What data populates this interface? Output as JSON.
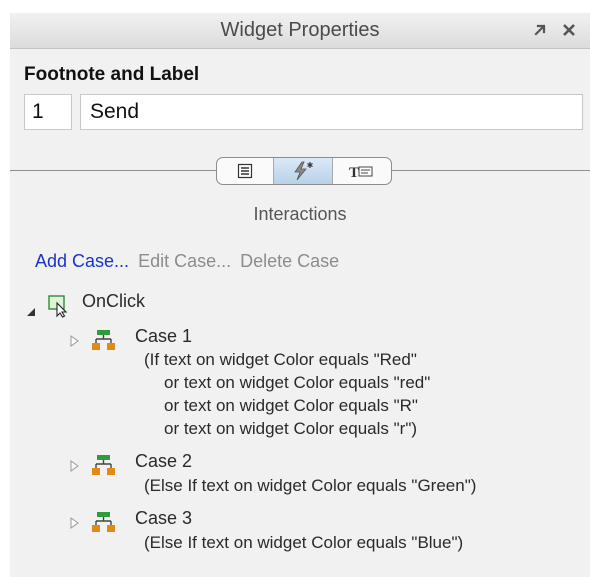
{
  "window": {
    "title": "Widget Properties",
    "pin_icon": "pin-icon",
    "close_icon": "close-icon"
  },
  "section": {
    "title": "Footnote and Label",
    "footnote_value": "1",
    "label_value": "Send"
  },
  "tabs": [
    {
      "name": "style",
      "icon": "notes-icon"
    },
    {
      "name": "interactions",
      "icon": "lightning-icon",
      "selected": true
    },
    {
      "name": "notes",
      "icon": "text-field-icon"
    }
  ],
  "subheading": "Interactions",
  "actions": {
    "add": "Add Case...",
    "edit": "Edit Case...",
    "delete": "Delete Case"
  },
  "event": {
    "name": "OnClick",
    "cases": [
      {
        "name": "Case 1",
        "conditions": [
          "(If text on widget Color equals \"Red\"",
          "or text on widget Color equals \"red\"",
          "or text on widget Color equals \"R\"",
          "or text on widget Color equals \"r\")"
        ]
      },
      {
        "name": "Case 2",
        "conditions": [
          "(Else If text on widget Color equals \"Green\")"
        ]
      },
      {
        "name": "Case 3",
        "conditions": [
          "(Else If text on widget Color equals \"Blue\")"
        ]
      }
    ]
  },
  "colors": {
    "link": "#1a33cc",
    "disabled": "#8c8c8c",
    "selected_tab": "#c4d9ee"
  }
}
